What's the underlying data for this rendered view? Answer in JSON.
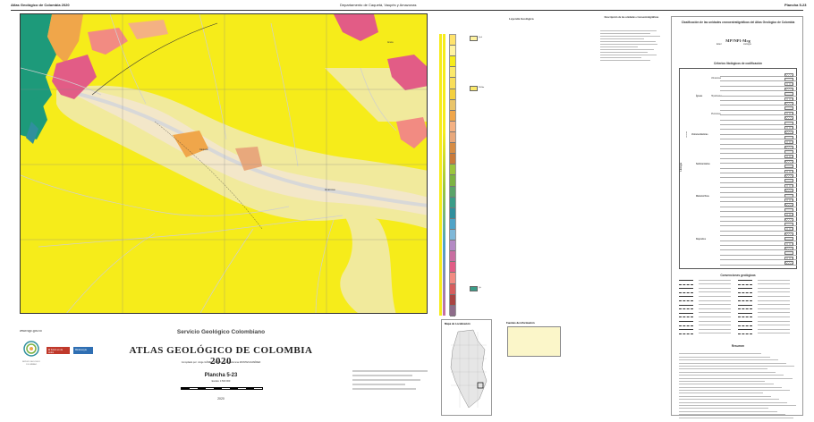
{
  "header": {
    "left": "Atlas Geológico de Colombia 2020",
    "center": "Departamento de Caquetá, Vaupés y Amazonas",
    "right": "Plancha 5-23"
  },
  "map": {
    "labels": [
      "Araca",
      "Caquetá",
      "Amazonas"
    ],
    "colors": {
      "background": "#f6ec1a",
      "river_zone": "#f1ea9c",
      "alluvial": "#f3e7c9",
      "green": "#1d9a7a",
      "pink": "#e25c86",
      "orange": "#f0a64a",
      "river": "#dcdcdc"
    }
  },
  "titleblock": {
    "website": "www.sgc.gov.co",
    "org": "Servicio Geológico Colombiano",
    "title": "ATLAS GEOLÓGICO DE COLOMBIA 2020",
    "compiled": "Compilado por: Jorge GÓMEZ TAPIAS y Nohora Emma MONTES RAMÍREZ",
    "plancha": "Plancha 5-23",
    "scale": "Escala: 1:500 000",
    "year": "2020",
    "logo_sgc": "SERVICIO GEOLÓGICO COLOMBIANO",
    "logo_gov": "El futuro es de todos",
    "logo_min": "MinEnergía"
  },
  "legend": {
    "title": "Leyenda Geológica",
    "desc_title": "Descripción de las unidades cronoestratigráficas",
    "unit_colors": [
      "#ffe36b",
      "#fff3a0",
      "#f6ec1a",
      "#fbe96a",
      "#f9de5a",
      "#f4d03f",
      "#e9c46a",
      "#f0a64a",
      "#f4b183",
      "#e8a87c",
      "#d68c45",
      "#c97a3a",
      "#9bc53d",
      "#7cb342",
      "#5aa469",
      "#3a9d88",
      "#2f8f9d",
      "#4fa3c7",
      "#7fb8d8",
      "#b48ac4",
      "#c96ea1",
      "#e25c86",
      "#f28b82",
      "#d65d5d",
      "#a94442",
      "#8e6c8a"
    ],
    "swatch_labels": [
      "Q-al",
      "N1-Sm",
      "Q-t"
    ]
  },
  "locmap": {
    "title": "Mapa de Localización",
    "sources_title": "Fuentes de información"
  },
  "rpanel": {
    "title": "Clasificación de las unidades cronoestratigráficas del Atlas Geológico de Colombia",
    "code": "MP?NP1-Mcg",
    "edad": "Edad",
    "litologia": "Litología",
    "criterios_title": "Criterios litológicos de codificación",
    "groups": [
      "Ígneas",
      "Volcanoclásticas",
      "Sedimentarias",
      "Metamórficas",
      "Depósitos"
    ],
    "sub_igneas": [
      "Volcánicas",
      "Hipabisales",
      "Plutónicas"
    ],
    "roca": "Rocas",
    "litologia_vert": "Litología",
    "conv_title": "Convenciones geológicas",
    "resumen_title": "Resumen"
  }
}
